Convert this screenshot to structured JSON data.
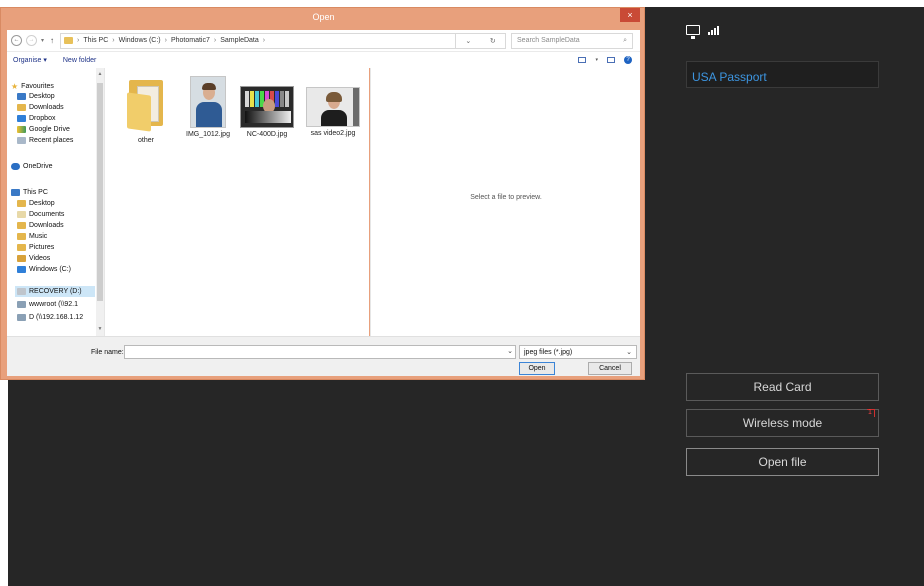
{
  "dialog": {
    "title": "Open",
    "close_label": "×",
    "breadcrumb": [
      "This PC",
      "Windows (C:)",
      "Photomatic7",
      "SampleData"
    ],
    "search_placeholder": "Search SampleData",
    "toolbar": {
      "organise": "Organise ▾",
      "new_folder": "New folder"
    },
    "nav": {
      "favourites": "Favourites",
      "fav_items": [
        "Desktop",
        "Downloads",
        "Dropbox",
        "Google Drive",
        "Recent places"
      ],
      "onedrive": "OneDrive",
      "this_pc": "This PC",
      "pc_items": [
        "Desktop",
        "Documents",
        "Downloads",
        "Music",
        "Pictures",
        "Videos",
        "Windows (C:)",
        "RECOVERY (D:)",
        "wwwroot (\\\\92.1",
        "D (\\\\192.168.1.12"
      ],
      "selected": "Windows (C:)"
    },
    "files": [
      {
        "name": "other",
        "kind": "folder"
      },
      {
        "name": "IMG_1012.jpg",
        "kind": "portrait"
      },
      {
        "name": "NC-400D.jpg",
        "kind": "chart"
      },
      {
        "name": "sas video2.jpg",
        "kind": "woman"
      }
    ],
    "preview_text": "Select a file to preview.",
    "file_name_label": "File name:",
    "file_name_value": "",
    "filter": "jpeg files (*.jpg)",
    "open_button": "Open",
    "cancel_button": "Cancel"
  },
  "panel": {
    "doc_type": "USA Passport",
    "read_card": "Read Card",
    "wireless_mode": "Wireless mode",
    "wireless_badge": "1",
    "open_file": "Open file"
  },
  "colors": {
    "app_bg": "#262626",
    "accent_blue": "#3d95e0",
    "dialog_frame": "#e8a07c",
    "close_red": "#c94a36"
  }
}
